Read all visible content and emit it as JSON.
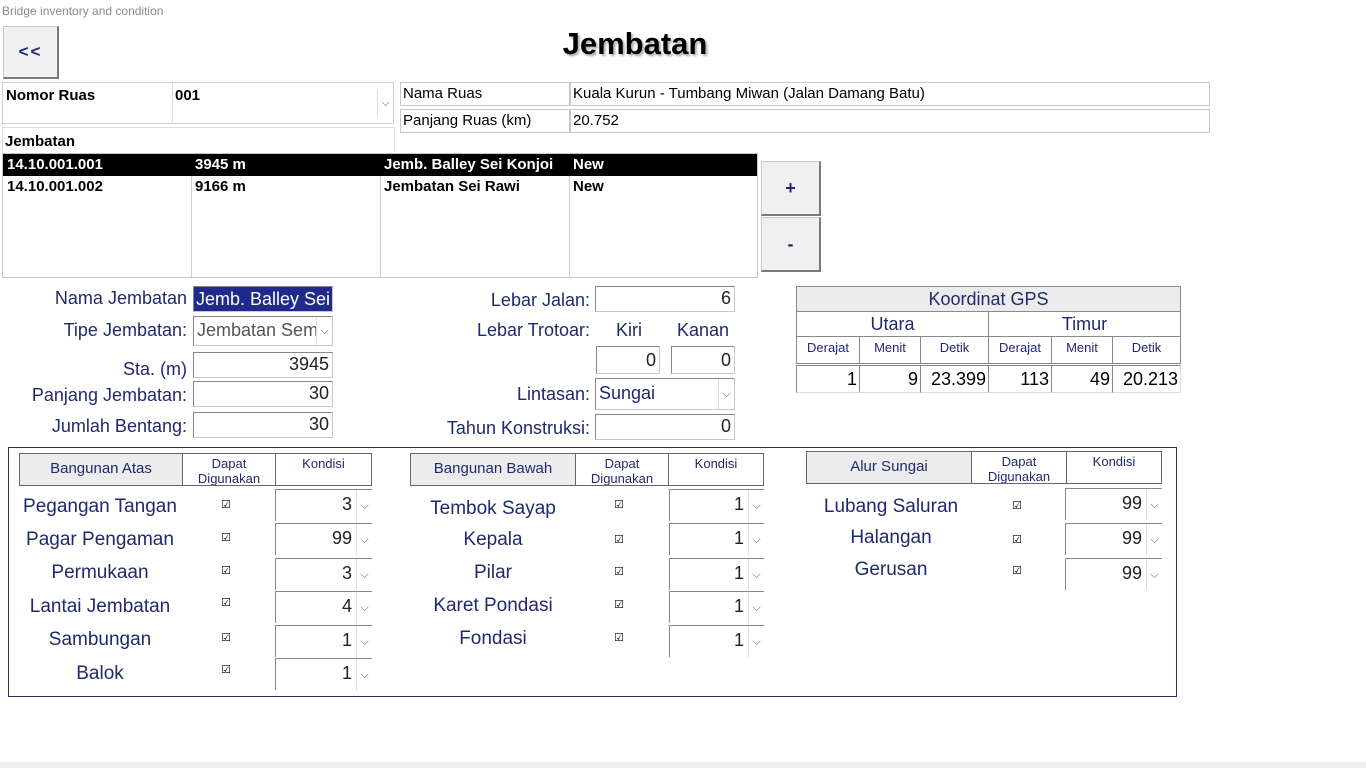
{
  "app_title": "Bridge inventory and condition",
  "back_label": "<<",
  "page_title": "Jembatan",
  "ruas": {
    "nomor_label": "Nomor Ruas",
    "nomor_value": "001",
    "nama_label": "Nama Ruas",
    "nama_value": "Kuala Kurun - Tumbang Miwan (Jalan Damang Batu)",
    "panjang_label": "Panjang Ruas (km)",
    "panjang_value": "20.752"
  },
  "list_header": "Jembatan",
  "bridges": [
    {
      "code": "14.10.001.001",
      "length": "3945 m",
      "name": "Jemb. Balley Sei Konjoi",
      "status": "New"
    },
    {
      "code": "14.10.001.002",
      "length": "9166 m",
      "name": "Jembatan Sei Rawi",
      "status": "New"
    }
  ],
  "add_label": "+",
  "remove_label": "-",
  "detail": {
    "nama_label": "Nama Jembatan",
    "nama_value": "Jemb. Balley Sei",
    "tipe_label": "Tipe Jembatan:",
    "tipe_value": "Jembatan Sem",
    "sta_label": "Sta. (m)",
    "sta_value": "3945",
    "panjang_label": "Panjang Jembatan:",
    "panjang_value": "30",
    "bentang_label": "Jumlah Bentang:",
    "bentang_value": "30",
    "lebar_jalan_label": "Lebar Jalan:",
    "lebar_jalan_value": "6",
    "lebar_trotoar_label": "Lebar Trotoar:",
    "kiri_label": "Kiri",
    "kanan_label": "Kanan",
    "kiri_value": "0",
    "kanan_value": "0",
    "lintasan_label": "Lintasan:",
    "lintasan_value": "Sungai",
    "tahun_label": "Tahun Konstruksi:",
    "tahun_value": "0"
  },
  "gps": {
    "title": "Koordinat GPS",
    "utara": "Utara",
    "timur": "Timur",
    "derajat": "Derajat",
    "menit": "Menit",
    "detik": "Detik",
    "utara_values": [
      "1",
      "9",
      "23.399"
    ],
    "timur_values": [
      "113",
      "49",
      "20.213"
    ]
  },
  "condition": {
    "dapat_label": "Dapat Digunakan",
    "kondisi_label": "Kondisi",
    "check_glyph": "☑",
    "atas": {
      "title": "Bangunan Atas",
      "items": [
        {
          "label": "Pegangan Tangan",
          "kondisi": "3"
        },
        {
          "label": "Pagar Pengaman",
          "kondisi": "99"
        },
        {
          "label": "Permukaan",
          "kondisi": "3"
        },
        {
          "label": "Lantai Jembatan",
          "kondisi": "4"
        },
        {
          "label": "Sambungan",
          "kondisi": "1"
        },
        {
          "label": "Balok",
          "kondisi": "1"
        }
      ]
    },
    "bawah": {
      "title": "Bangunan Bawah",
      "items": [
        {
          "label": "Tembok Sayap",
          "kondisi": "1"
        },
        {
          "label": "Kepala",
          "kondisi": "1"
        },
        {
          "label": "Pilar",
          "kondisi": "1"
        },
        {
          "label": "Karet Pondasi",
          "kondisi": "1"
        },
        {
          "label": "Fondasi",
          "kondisi": "1"
        }
      ]
    },
    "sungai": {
      "title": "Alur Sungai",
      "items": [
        {
          "label": "Lubang Saluran",
          "kondisi": "99"
        },
        {
          "label": "Halangan",
          "kondisi": "99"
        },
        {
          "label": "Gerusan",
          "kondisi": "99"
        }
      ]
    }
  },
  "chevron_glyph": "⌵"
}
